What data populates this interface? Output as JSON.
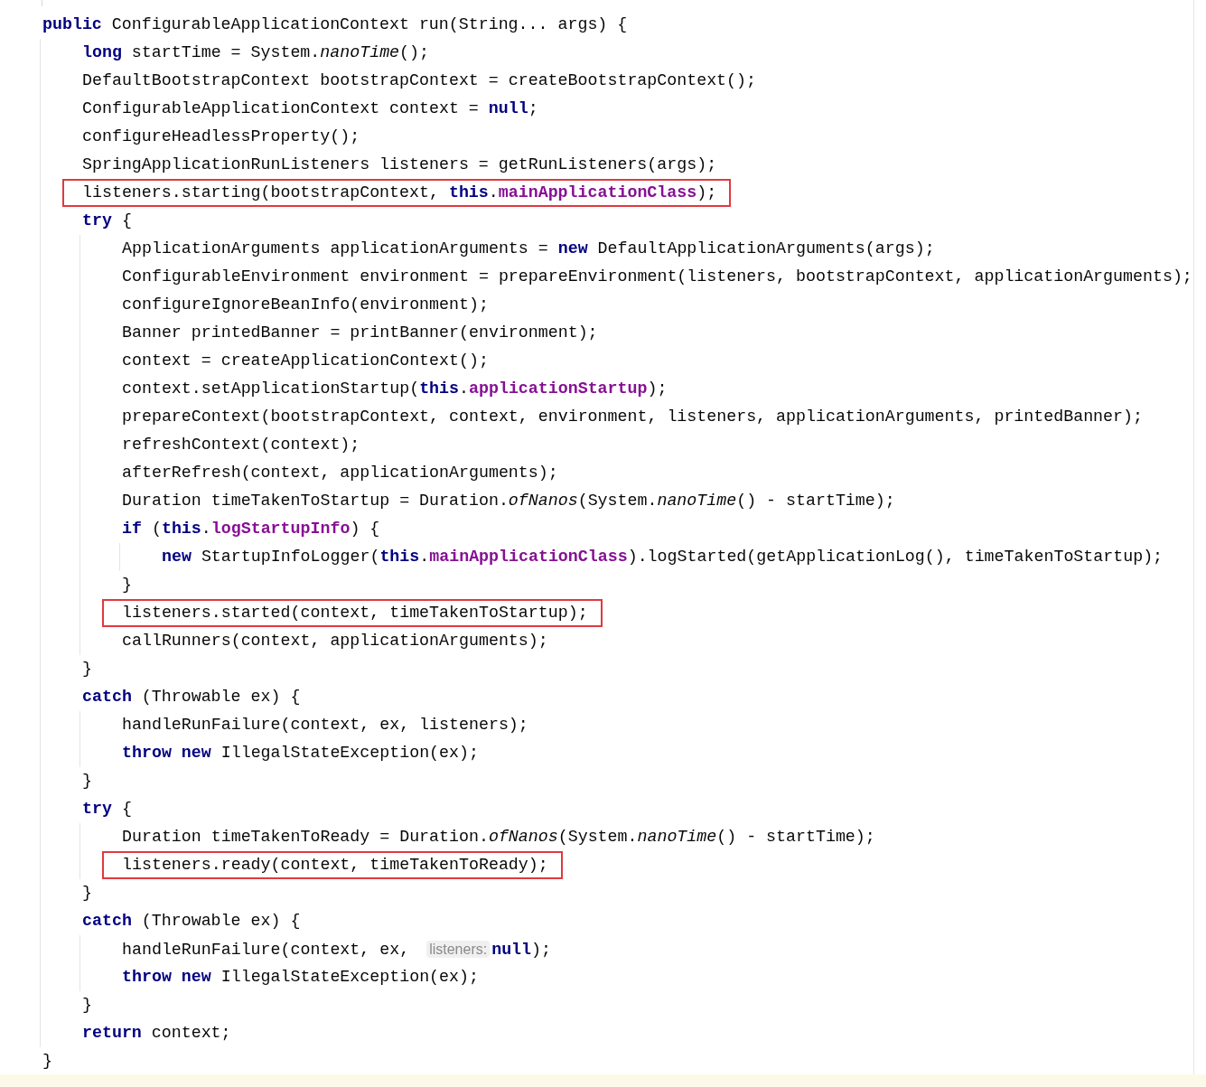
{
  "editor": {
    "lines": [
      {
        "boxed": false,
        "tokens": [
          {
            "kind": "kw",
            "text": "public"
          },
          {
            "kind": "text",
            "text": " ConfigurableApplicationContext run(String... args) {"
          }
        ],
        "children": [
          {
            "boxed": false,
            "tokens": [
              {
                "kind": "kw",
                "text": "long"
              },
              {
                "kind": "text",
                "text": " startTime = System."
              },
              {
                "kind": "static",
                "text": "nanoTime"
              },
              {
                "kind": "text",
                "text": "();"
              }
            ]
          },
          {
            "boxed": false,
            "tokens": [
              {
                "kind": "text",
                "text": "DefaultBootstrapContext bootstrapContext = createBootstrapContext();"
              }
            ]
          },
          {
            "boxed": false,
            "tokens": [
              {
                "kind": "text",
                "text": "ConfigurableApplicationContext context = "
              },
              {
                "kind": "kw",
                "text": "null"
              },
              {
                "kind": "text",
                "text": ";"
              }
            ]
          },
          {
            "boxed": false,
            "tokens": [
              {
                "kind": "text",
                "text": "configureHeadlessProperty();"
              }
            ]
          },
          {
            "boxed": false,
            "tokens": [
              {
                "kind": "text",
                "text": "SpringApplicationRunListeners listeners = getRunListeners(args);"
              }
            ]
          },
          {
            "boxed": true,
            "tokens": [
              {
                "kind": "text",
                "text": "listeners.starting(bootstrapContext, "
              },
              {
                "kind": "kw",
                "text": "this"
              },
              {
                "kind": "text",
                "text": "."
              },
              {
                "kind": "field",
                "text": "mainApplicationClass"
              },
              {
                "kind": "text",
                "text": ");"
              }
            ]
          },
          {
            "boxed": false,
            "tokens": [
              {
                "kind": "kw",
                "text": "try"
              },
              {
                "kind": "text",
                "text": " {"
              }
            ],
            "children": [
              {
                "boxed": false,
                "tokens": [
                  {
                    "kind": "text",
                    "text": "ApplicationArguments applicationArguments = "
                  },
                  {
                    "kind": "kw",
                    "text": "new"
                  },
                  {
                    "kind": "text",
                    "text": " DefaultApplicationArguments(args);"
                  }
                ]
              },
              {
                "boxed": false,
                "tokens": [
                  {
                    "kind": "text",
                    "text": "ConfigurableEnvironment environment = prepareEnvironment(listeners, bootstrapContext, applicationArguments);"
                  }
                ]
              },
              {
                "boxed": false,
                "tokens": [
                  {
                    "kind": "text",
                    "text": "configureIgnoreBeanInfo(environment);"
                  }
                ]
              },
              {
                "boxed": false,
                "tokens": [
                  {
                    "kind": "text",
                    "text": "Banner printedBanner = printBanner(environment);"
                  }
                ]
              },
              {
                "boxed": false,
                "tokens": [
                  {
                    "kind": "text",
                    "text": "context = createApplicationContext();"
                  }
                ]
              },
              {
                "boxed": false,
                "tokens": [
                  {
                    "kind": "text",
                    "text": "context.setApplicationStartup("
                  },
                  {
                    "kind": "kw",
                    "text": "this"
                  },
                  {
                    "kind": "text",
                    "text": "."
                  },
                  {
                    "kind": "field",
                    "text": "applicationStartup"
                  },
                  {
                    "kind": "text",
                    "text": ");"
                  }
                ]
              },
              {
                "boxed": false,
                "tokens": [
                  {
                    "kind": "text",
                    "text": "prepareContext(bootstrapContext, context, environment, listeners, applicationArguments, printedBanner);"
                  }
                ]
              },
              {
                "boxed": false,
                "tokens": [
                  {
                    "kind": "text",
                    "text": "refreshContext(context);"
                  }
                ]
              },
              {
                "boxed": false,
                "tokens": [
                  {
                    "kind": "text",
                    "text": "afterRefresh(context, applicationArguments);"
                  }
                ]
              },
              {
                "boxed": false,
                "tokens": [
                  {
                    "kind": "text",
                    "text": "Duration timeTakenToStartup = Duration."
                  },
                  {
                    "kind": "static",
                    "text": "ofNanos"
                  },
                  {
                    "kind": "text",
                    "text": "(System."
                  },
                  {
                    "kind": "static",
                    "text": "nanoTime"
                  },
                  {
                    "kind": "text",
                    "text": "() - startTime);"
                  }
                ]
              },
              {
                "boxed": false,
                "tokens": [
                  {
                    "kind": "kw",
                    "text": "if"
                  },
                  {
                    "kind": "text",
                    "text": " ("
                  },
                  {
                    "kind": "kw",
                    "text": "this"
                  },
                  {
                    "kind": "text",
                    "text": "."
                  },
                  {
                    "kind": "field",
                    "text": "logStartupInfo"
                  },
                  {
                    "kind": "text",
                    "text": ") {"
                  }
                ],
                "children": [
                  {
                    "boxed": false,
                    "tokens": [
                      {
                        "kind": "kw",
                        "text": "new"
                      },
                      {
                        "kind": "text",
                        "text": " StartupInfoLogger("
                      },
                      {
                        "kind": "kw",
                        "text": "this"
                      },
                      {
                        "kind": "text",
                        "text": "."
                      },
                      {
                        "kind": "field",
                        "text": "mainApplicationClass"
                      },
                      {
                        "kind": "text",
                        "text": ").logStarted(getApplicationLog(), timeTakenToStartup);"
                      }
                    ]
                  }
                ]
              },
              {
                "boxed": false,
                "tokens": [
                  {
                    "kind": "text",
                    "text": "}"
                  }
                ]
              },
              {
                "boxed": true,
                "tokens": [
                  {
                    "kind": "text",
                    "text": "listeners.started(context, timeTakenToStartup);"
                  }
                ]
              },
              {
                "boxed": false,
                "tokens": [
                  {
                    "kind": "text",
                    "text": "callRunners(context, applicationArguments);"
                  }
                ]
              }
            ]
          },
          {
            "boxed": false,
            "tokens": [
              {
                "kind": "text",
                "text": "}"
              }
            ]
          },
          {
            "boxed": false,
            "tokens": [
              {
                "kind": "kw",
                "text": "catch"
              },
              {
                "kind": "text",
                "text": " (Throwable ex) {"
              }
            ],
            "children": [
              {
                "boxed": false,
                "tokens": [
                  {
                    "kind": "text",
                    "text": "handleRunFailure(context, ex, listeners);"
                  }
                ]
              },
              {
                "boxed": false,
                "tokens": [
                  {
                    "kind": "kw",
                    "text": "throw new"
                  },
                  {
                    "kind": "text",
                    "text": " IllegalStateException(ex);"
                  }
                ]
              }
            ]
          },
          {
            "boxed": false,
            "tokens": [
              {
                "kind": "text",
                "text": "}"
              }
            ]
          },
          {
            "boxed": false,
            "tokens": [
              {
                "kind": "kw",
                "text": "try"
              },
              {
                "kind": "text",
                "text": " {"
              }
            ],
            "children": [
              {
                "boxed": false,
                "tokens": [
                  {
                    "kind": "text",
                    "text": "Duration timeTakenToReady = Duration."
                  },
                  {
                    "kind": "static",
                    "text": "ofNanos"
                  },
                  {
                    "kind": "text",
                    "text": "(System."
                  },
                  {
                    "kind": "static",
                    "text": "nanoTime"
                  },
                  {
                    "kind": "text",
                    "text": "() - startTime);"
                  }
                ]
              },
              {
                "boxed": true,
                "tokens": [
                  {
                    "kind": "text",
                    "text": "listeners.ready(context, timeTakenToReady);"
                  }
                ]
              }
            ]
          },
          {
            "boxed": false,
            "tokens": [
              {
                "kind": "text",
                "text": "}"
              }
            ]
          },
          {
            "boxed": false,
            "tokens": [
              {
                "kind": "kw",
                "text": "catch"
              },
              {
                "kind": "text",
                "text": " (Throwable ex) {"
              }
            ],
            "children": [
              {
                "boxed": false,
                "tokens": [
                  {
                    "kind": "text",
                    "text": "handleRunFailure(context, ex, "
                  },
                  {
                    "kind": "hint",
                    "text": "listeners:"
                  },
                  {
                    "kind": "kw",
                    "text": "null"
                  },
                  {
                    "kind": "text",
                    "text": ");"
                  }
                ]
              },
              {
                "boxed": false,
                "tokens": [
                  {
                    "kind": "kw",
                    "text": "throw new"
                  },
                  {
                    "kind": "text",
                    "text": " IllegalStateException(ex);"
                  }
                ]
              }
            ]
          },
          {
            "boxed": false,
            "tokens": [
              {
                "kind": "text",
                "text": "}"
              }
            ]
          },
          {
            "boxed": false,
            "tokens": [
              {
                "kind": "kw",
                "text": "return"
              },
              {
                "kind": "text",
                "text": " context;"
              }
            ]
          }
        ]
      },
      {
        "boxed": false,
        "tokens": [
          {
            "kind": "text",
            "text": "}"
          }
        ]
      }
    ]
  }
}
